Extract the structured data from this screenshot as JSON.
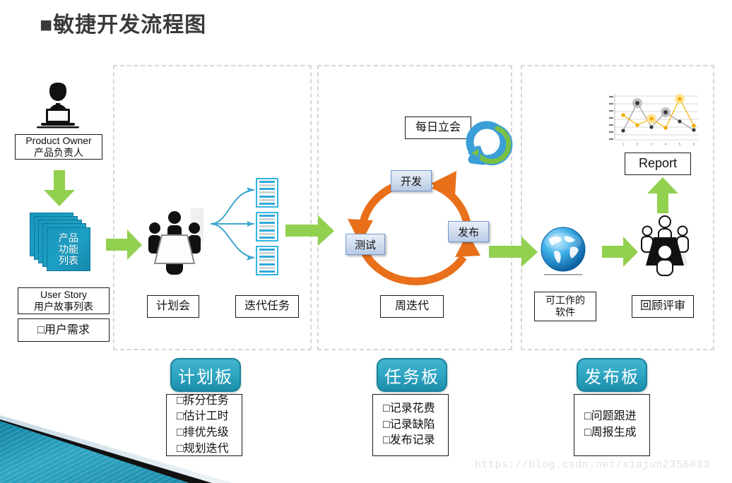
{
  "title": "■敏捷开发流程图",
  "watermark": "https://blog.csdn.net/xiajun2356033",
  "colors": {
    "green_arrow": "#92D050",
    "teal_card": "#1d9fc4",
    "orange_cycle": "#E8701A",
    "doc_blue": "#35b4e3",
    "board_teal": "#2fa6c3",
    "dashed_border": "#d6d6d6",
    "title_gray": "#3a3a3a"
  },
  "left_column": {
    "owner_icon": "person-with-laptop-icon",
    "owner_box": {
      "line1": "Product Owner",
      "line2": "产品负责人"
    },
    "arrow_down": "green-down-arrow",
    "product_stack": {
      "line1": "产品",
      "line2": "功能",
      "line3": "列表"
    },
    "user_story_box": {
      "line1": "User Story",
      "line2": "用户故事列表"
    },
    "requirement_box": {
      "line1": "□用户需求"
    }
  },
  "section1": {
    "meeting_icon": "meeting-table-icon",
    "meeting_label": "计划会",
    "task_docs_label": "迭代任务",
    "doc_count": 3
  },
  "section2": {
    "standup_label": "每日立会",
    "loop_icon": "green-circular-arrow-icon",
    "cycle": {
      "develop": "开发",
      "test": "测试",
      "release": "发布"
    },
    "iteration_label": "周迭代"
  },
  "section3": {
    "globe_icon": "globe-icon",
    "software_box": {
      "line1": "可工作的",
      "line2": "软件"
    },
    "review_icon": "meeting-table-icon",
    "review_label": "回顾评审",
    "report_label": "Report",
    "report_chart_icon": "line-chart-icon"
  },
  "boards": [
    {
      "name": "计划板",
      "items": [
        "□拆分任务",
        "□估计工时",
        "□排优先级",
        "□规划迭代"
      ]
    },
    {
      "name": "任务板",
      "items": [
        "□记录花费",
        "□记录缺陷",
        "□发布记录"
      ]
    },
    {
      "name": "发布板",
      "items": [
        "□问题跟进",
        "□周报生成"
      ]
    }
  ],
  "chart_data": {
    "type": "line",
    "title": "",
    "xlabel": "",
    "ylabel": "",
    "categories": [
      "1",
      "2",
      "3",
      "4",
      "5",
      "6"
    ],
    "series": [
      {
        "name": "series-dark",
        "values": [
          18,
          72,
          30,
          56,
          40,
          20
        ]
      },
      {
        "name": "series-amber",
        "values": [
          52,
          26,
          44,
          20,
          84,
          26
        ]
      }
    ],
    "ylim": [
      0,
      100
    ],
    "grid": true,
    "legend": "none"
  }
}
